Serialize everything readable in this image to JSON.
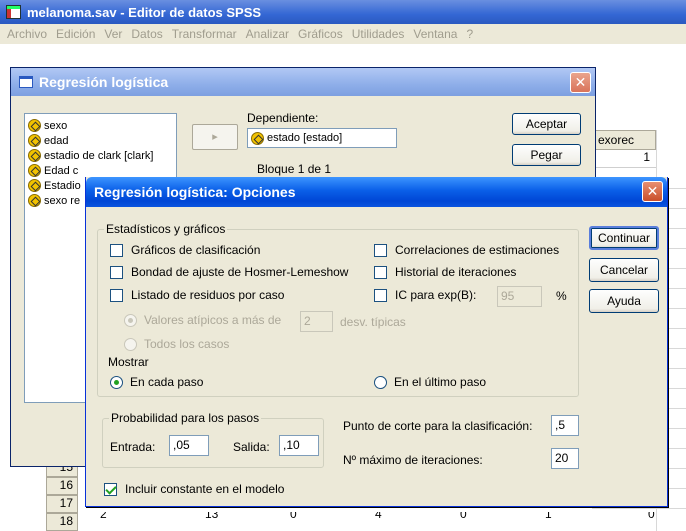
{
  "main_window": {
    "title": "melanoma.sav - Editor de datos SPSS",
    "menu": [
      "Archivo",
      "Edición",
      "Ver",
      "Datos",
      "Transformar",
      "Analizar",
      "Gráficos",
      "Utilidades",
      "Ventana",
      "?"
    ],
    "column_header": "exorec",
    "first_cell_value": "1",
    "row_numbers": [
      "15",
      "16",
      "17",
      "18"
    ],
    "bottom_row_values": [
      "2",
      "13",
      "0",
      "4",
      "0",
      "1",
      "0"
    ]
  },
  "logistic_dialog": {
    "title": "Regresión logística",
    "close_label": "✕",
    "variables": [
      {
        "label": "sexo"
      },
      {
        "label": "edad"
      },
      {
        "label": "estadio de clark [clark]"
      },
      {
        "label": "Edad c"
      },
      {
        "label": "Estadio"
      },
      {
        "label": "sexo re"
      }
    ],
    "move_button": "▸",
    "dependent_label": "Dependiente:",
    "dependent_value": "estado [estado]",
    "block_label": "Bloque 1 de 1",
    "buttons": {
      "ok": "Aceptar",
      "paste": "Pegar"
    }
  },
  "options_dialog": {
    "title": "Regresión logística: Opciones",
    "close_label": "✕",
    "stats_group_label": "Estadísticos y gráficos",
    "checkboxes": {
      "classification_plots": {
        "label": "Gráficos de clasificación",
        "checked": false
      },
      "hosmer_lemeshow": {
        "label": "Bondad de ajuste de Hosmer-Lemeshow",
        "checked": false
      },
      "casewise_residuals": {
        "label": "Listado de residuos por caso",
        "checked": false
      },
      "estimate_correlations": {
        "label": "Correlaciones de estimaciones",
        "checked": false
      },
      "iteration_history": {
        "label": "Historial de iteraciones",
        "checked": false
      },
      "ci_exp_b": {
        "label": "IC para exp(B):",
        "checked": false,
        "value": "95",
        "unit": "%"
      },
      "include_constant": {
        "label": "Incluir constante en el modelo",
        "checked": true
      }
    },
    "outliers": {
      "label": "Valores atípicos a más de",
      "value": "2",
      "suffix": "desv. típicas",
      "all_cases_label": "Todos los casos"
    },
    "display_group_label": "Mostrar",
    "display_each_step": "En cada paso",
    "display_last_step": "En el último paso",
    "prob_group_label": "Probabilidad para los pasos",
    "entry_label": "Entrada:",
    "entry_value": ",05",
    "removal_label": "Salida:",
    "removal_value": ",10",
    "cutoff_label": "Punto de corte para la clasificación:",
    "cutoff_value": ",5",
    "max_iter_label": "Nº máximo de iteraciones:",
    "max_iter_value": "20",
    "buttons": {
      "continue": "Continuar",
      "cancel": "Cancelar",
      "help": "Ayuda"
    }
  }
}
